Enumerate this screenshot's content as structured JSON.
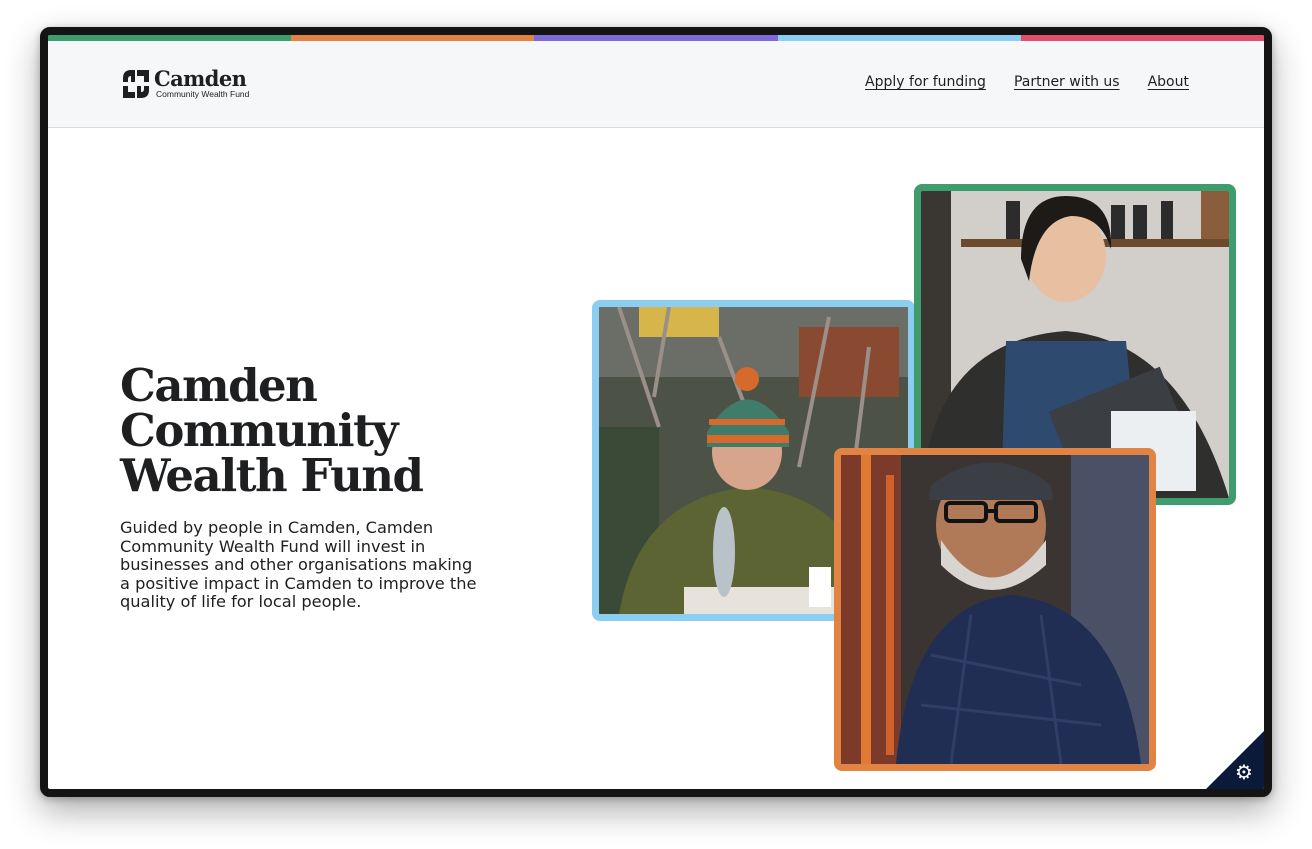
{
  "colors": {
    "stripes": [
      "#3f9c6f",
      "#e18343",
      "#7d6ad8",
      "#8ccdf2",
      "#e0506c"
    ],
    "text": "#1e1f21",
    "header_bg": "#f6f7f9",
    "corner_bg": "#0c1a3a"
  },
  "header": {
    "logo": {
      "name": "Camden",
      "subtitle": "Community Wealth Fund"
    },
    "nav": [
      {
        "label": "Apply for funding"
      },
      {
        "label": "Partner with us"
      },
      {
        "label": "About"
      }
    ]
  },
  "hero": {
    "title_lines": [
      "Camden",
      "Community",
      "Wealth Fund"
    ],
    "description": "Guided by people in Camden, Camden Community Wealth Fund will invest in businesses and other organisations making a positive impact in Camden to improve the quality of life for local people."
  },
  "photos": [
    {
      "border_color": "#8ccdf2",
      "icon": "person-photo"
    },
    {
      "border_color": "#3f9c6f",
      "icon": "person-photo"
    },
    {
      "border_color": "#e18343",
      "icon": "person-photo"
    }
  ],
  "corner": {
    "icon": "gear-icon"
  }
}
